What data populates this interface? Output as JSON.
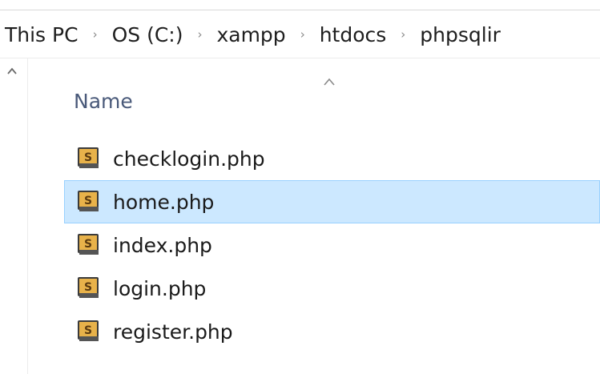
{
  "breadcrumb": {
    "items": [
      {
        "label": "This PC"
      },
      {
        "label": "OS (C:)"
      },
      {
        "label": "xampp"
      },
      {
        "label": "htdocs"
      },
      {
        "label": "phpsqlir"
      }
    ],
    "separator": "›"
  },
  "file_list": {
    "column_header": "Name",
    "sort": "ascending",
    "files": [
      {
        "name": "checklogin.php",
        "icon": "php-file-icon",
        "selected": false
      },
      {
        "name": "home.php",
        "icon": "php-file-icon",
        "selected": true
      },
      {
        "name": "index.php",
        "icon": "php-file-icon",
        "selected": false
      },
      {
        "name": "login.php",
        "icon": "php-file-icon",
        "selected": false
      },
      {
        "name": "register.php",
        "icon": "php-file-icon",
        "selected": false
      }
    ]
  },
  "colors": {
    "selection_bg": "#cce8ff",
    "selection_border": "#99d1ff",
    "header_text": "#4a5a7a"
  }
}
